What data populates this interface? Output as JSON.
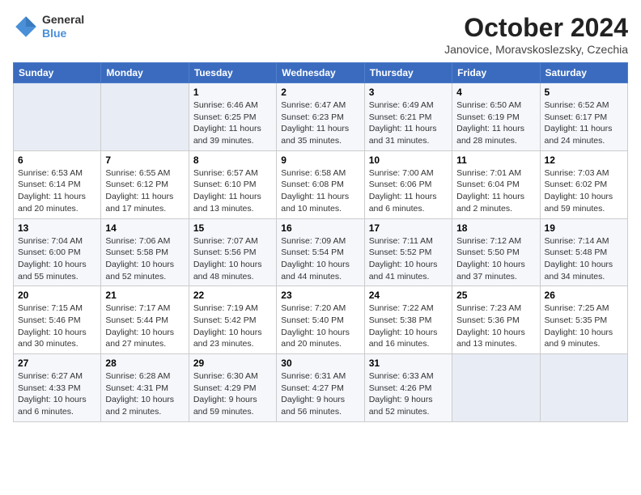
{
  "logo": {
    "general": "General",
    "blue": "Blue"
  },
  "title": "October 2024",
  "subtitle": "Janovice, Moravskoslezsky, Czechia",
  "headers": [
    "Sunday",
    "Monday",
    "Tuesday",
    "Wednesday",
    "Thursday",
    "Friday",
    "Saturday"
  ],
  "weeks": [
    [
      {
        "day": "",
        "sunrise": "",
        "sunset": "",
        "daylight": ""
      },
      {
        "day": "",
        "sunrise": "",
        "sunset": "",
        "daylight": ""
      },
      {
        "day": "1",
        "sunrise": "Sunrise: 6:46 AM",
        "sunset": "Sunset: 6:25 PM",
        "daylight": "Daylight: 11 hours and 39 minutes."
      },
      {
        "day": "2",
        "sunrise": "Sunrise: 6:47 AM",
        "sunset": "Sunset: 6:23 PM",
        "daylight": "Daylight: 11 hours and 35 minutes."
      },
      {
        "day": "3",
        "sunrise": "Sunrise: 6:49 AM",
        "sunset": "Sunset: 6:21 PM",
        "daylight": "Daylight: 11 hours and 31 minutes."
      },
      {
        "day": "4",
        "sunrise": "Sunrise: 6:50 AM",
        "sunset": "Sunset: 6:19 PM",
        "daylight": "Daylight: 11 hours and 28 minutes."
      },
      {
        "day": "5",
        "sunrise": "Sunrise: 6:52 AM",
        "sunset": "Sunset: 6:17 PM",
        "daylight": "Daylight: 11 hours and 24 minutes."
      }
    ],
    [
      {
        "day": "6",
        "sunrise": "Sunrise: 6:53 AM",
        "sunset": "Sunset: 6:14 PM",
        "daylight": "Daylight: 11 hours and 20 minutes."
      },
      {
        "day": "7",
        "sunrise": "Sunrise: 6:55 AM",
        "sunset": "Sunset: 6:12 PM",
        "daylight": "Daylight: 11 hours and 17 minutes."
      },
      {
        "day": "8",
        "sunrise": "Sunrise: 6:57 AM",
        "sunset": "Sunset: 6:10 PM",
        "daylight": "Daylight: 11 hours and 13 minutes."
      },
      {
        "day": "9",
        "sunrise": "Sunrise: 6:58 AM",
        "sunset": "Sunset: 6:08 PM",
        "daylight": "Daylight: 11 hours and 10 minutes."
      },
      {
        "day": "10",
        "sunrise": "Sunrise: 7:00 AM",
        "sunset": "Sunset: 6:06 PM",
        "daylight": "Daylight: 11 hours and 6 minutes."
      },
      {
        "day": "11",
        "sunrise": "Sunrise: 7:01 AM",
        "sunset": "Sunset: 6:04 PM",
        "daylight": "Daylight: 11 hours and 2 minutes."
      },
      {
        "day": "12",
        "sunrise": "Sunrise: 7:03 AM",
        "sunset": "Sunset: 6:02 PM",
        "daylight": "Daylight: 10 hours and 59 minutes."
      }
    ],
    [
      {
        "day": "13",
        "sunrise": "Sunrise: 7:04 AM",
        "sunset": "Sunset: 6:00 PM",
        "daylight": "Daylight: 10 hours and 55 minutes."
      },
      {
        "day": "14",
        "sunrise": "Sunrise: 7:06 AM",
        "sunset": "Sunset: 5:58 PM",
        "daylight": "Daylight: 10 hours and 52 minutes."
      },
      {
        "day": "15",
        "sunrise": "Sunrise: 7:07 AM",
        "sunset": "Sunset: 5:56 PM",
        "daylight": "Daylight: 10 hours and 48 minutes."
      },
      {
        "day": "16",
        "sunrise": "Sunrise: 7:09 AM",
        "sunset": "Sunset: 5:54 PM",
        "daylight": "Daylight: 10 hours and 44 minutes."
      },
      {
        "day": "17",
        "sunrise": "Sunrise: 7:11 AM",
        "sunset": "Sunset: 5:52 PM",
        "daylight": "Daylight: 10 hours and 41 minutes."
      },
      {
        "day": "18",
        "sunrise": "Sunrise: 7:12 AM",
        "sunset": "Sunset: 5:50 PM",
        "daylight": "Daylight: 10 hours and 37 minutes."
      },
      {
        "day": "19",
        "sunrise": "Sunrise: 7:14 AM",
        "sunset": "Sunset: 5:48 PM",
        "daylight": "Daylight: 10 hours and 34 minutes."
      }
    ],
    [
      {
        "day": "20",
        "sunrise": "Sunrise: 7:15 AM",
        "sunset": "Sunset: 5:46 PM",
        "daylight": "Daylight: 10 hours and 30 minutes."
      },
      {
        "day": "21",
        "sunrise": "Sunrise: 7:17 AM",
        "sunset": "Sunset: 5:44 PM",
        "daylight": "Daylight: 10 hours and 27 minutes."
      },
      {
        "day": "22",
        "sunrise": "Sunrise: 7:19 AM",
        "sunset": "Sunset: 5:42 PM",
        "daylight": "Daylight: 10 hours and 23 minutes."
      },
      {
        "day": "23",
        "sunrise": "Sunrise: 7:20 AM",
        "sunset": "Sunset: 5:40 PM",
        "daylight": "Daylight: 10 hours and 20 minutes."
      },
      {
        "day": "24",
        "sunrise": "Sunrise: 7:22 AM",
        "sunset": "Sunset: 5:38 PM",
        "daylight": "Daylight: 10 hours and 16 minutes."
      },
      {
        "day": "25",
        "sunrise": "Sunrise: 7:23 AM",
        "sunset": "Sunset: 5:36 PM",
        "daylight": "Daylight: 10 hours and 13 minutes."
      },
      {
        "day": "26",
        "sunrise": "Sunrise: 7:25 AM",
        "sunset": "Sunset: 5:35 PM",
        "daylight": "Daylight: 10 hours and 9 minutes."
      }
    ],
    [
      {
        "day": "27",
        "sunrise": "Sunrise: 6:27 AM",
        "sunset": "Sunset: 4:33 PM",
        "daylight": "Daylight: 10 hours and 6 minutes."
      },
      {
        "day": "28",
        "sunrise": "Sunrise: 6:28 AM",
        "sunset": "Sunset: 4:31 PM",
        "daylight": "Daylight: 10 hours and 2 minutes."
      },
      {
        "day": "29",
        "sunrise": "Sunrise: 6:30 AM",
        "sunset": "Sunset: 4:29 PM",
        "daylight": "Daylight: 9 hours and 59 minutes."
      },
      {
        "day": "30",
        "sunrise": "Sunrise: 6:31 AM",
        "sunset": "Sunset: 4:27 PM",
        "daylight": "Daylight: 9 hours and 56 minutes."
      },
      {
        "day": "31",
        "sunrise": "Sunrise: 6:33 AM",
        "sunset": "Sunset: 4:26 PM",
        "daylight": "Daylight: 9 hours and 52 minutes."
      },
      {
        "day": "",
        "sunrise": "",
        "sunset": "",
        "daylight": ""
      },
      {
        "day": "",
        "sunrise": "",
        "sunset": "",
        "daylight": ""
      }
    ]
  ]
}
